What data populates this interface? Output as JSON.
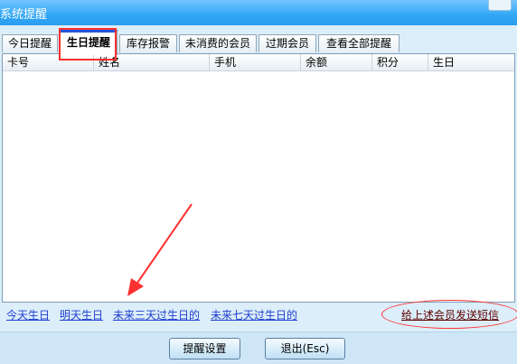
{
  "window": {
    "title": "系统提醒"
  },
  "tabs": [
    {
      "label": "今日提醒"
    },
    {
      "label": "生日提醒"
    },
    {
      "label": "库存报警"
    },
    {
      "label": "未消费的会员"
    },
    {
      "label": "过期会员"
    },
    {
      "label": "查看全部提醒"
    }
  ],
  "active_tab": "生日提醒",
  "table": {
    "columns": [
      "卡号",
      "姓名",
      "手机",
      "余额",
      "积分",
      "生日"
    ],
    "rows": []
  },
  "filters": [
    {
      "label": "今天生日"
    },
    {
      "label": "明天生日"
    },
    {
      "label": "未来三天过生日的"
    },
    {
      "label": "未来七天过生日的"
    }
  ],
  "send_sms_label": "给上述会员发送短信",
  "buttons": {
    "settings": "提醒设置",
    "exit": "退出(Esc)"
  },
  "colors": {
    "titlebar": "#32a7f5",
    "link": "#1f3fd0",
    "annotation": "#ff3030"
  }
}
